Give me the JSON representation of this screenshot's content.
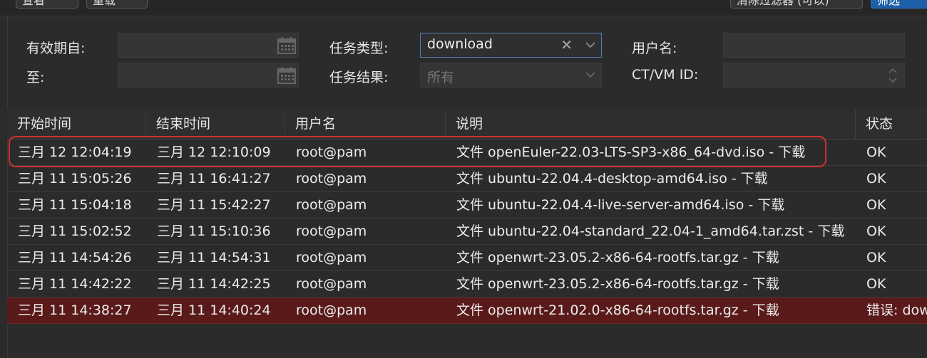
{
  "toolbar": {
    "left_buttons": [
      "查看",
      "重载"
    ],
    "right_buttons": [
      "清除过滤器 (可以)",
      "筛选"
    ]
  },
  "filters": {
    "since_label": "有效期自:",
    "until_label": "至:",
    "type_label": "任务类型:",
    "type_value": "download",
    "result_label": "任务结果:",
    "result_placeholder": "所有",
    "user_label": "用户名:",
    "vmid_label": "CT/VM ID:"
  },
  "table": {
    "headers": [
      "开始时间",
      "结束时间",
      "用户名",
      "说明",
      "状态"
    ],
    "rows": [
      {
        "start": "三月 12 12:04:19",
        "end": "三月 12 12:10:09",
        "user": "root@pam",
        "desc": "文件 openEuler-22.03-LTS-SP3-x86_64-dvd.iso - 下载",
        "status": "OK"
      },
      {
        "start": "三月 11 15:05:26",
        "end": "三月 11 16:41:27",
        "user": "root@pam",
        "desc": "文件 ubuntu-22.04.4-desktop-amd64.iso - 下载",
        "status": "OK"
      },
      {
        "start": "三月 11 15:04:18",
        "end": "三月 11 15:42:27",
        "user": "root@pam",
        "desc": "文件 ubuntu-22.04.4-live-server-amd64.iso - 下载",
        "status": "OK"
      },
      {
        "start": "三月 11 15:02:52",
        "end": "三月 11 15:10:36",
        "user": "root@pam",
        "desc": "文件 ubuntu-22.04-standard_22.04-1_amd64.tar.zst - 下载",
        "status": "OK"
      },
      {
        "start": "三月 11 14:54:26",
        "end": "三月 11 14:54:31",
        "user": "root@pam",
        "desc": "文件 openwrt-23.05.2-x86-64-rootfs.tar.gz - 下载",
        "status": "OK"
      },
      {
        "start": "三月 11 14:42:22",
        "end": "三月 11 14:42:25",
        "user": "root@pam",
        "desc": "文件 openwrt-23.05.2-x86-64-rootfs.tar.gz - 下载",
        "status": "OK"
      },
      {
        "start": "三月 11 14:38:27",
        "end": "三月 11 14:40:24",
        "user": "root@pam",
        "desc": "文件 openwrt-21.02.0-x86-64-rootfs.tar.gz - 下载",
        "status": "错误: dow"
      }
    ]
  },
  "colors": {
    "background": "#2b2b2b",
    "error_row": "#5a1a1a",
    "highlight_border": "#d03030",
    "accent": "#1f5fa8"
  }
}
